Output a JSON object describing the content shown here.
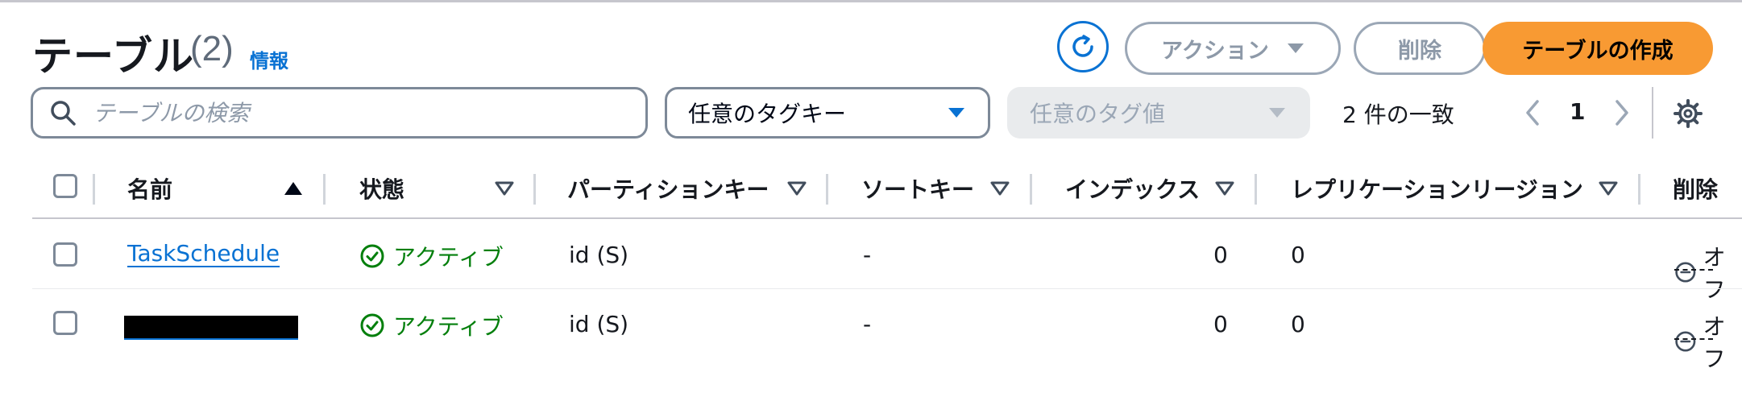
{
  "header": {
    "title": "テーブル",
    "count": "(2)",
    "info_link": "情報",
    "buttons": {
      "actions": "アクション",
      "delete": "削除",
      "create": "テーブルの作成"
    }
  },
  "filters": {
    "search_placeholder": "テーブルの検索",
    "tag_key_select": "任意のタグキー",
    "tag_value_select": "任意のタグ値",
    "match_count": "2 件の一致"
  },
  "pagination": {
    "current_page": "1"
  },
  "table": {
    "columns": {
      "name": "名前",
      "status": "状態",
      "partition_key": "パーティションキー",
      "sort_key": "ソートキー",
      "indexes": "インデックス",
      "replication_regions": "レプリケーションリージョン",
      "deletion_protection": "削除"
    },
    "rows": [
      {
        "name": "TaskSchedule",
        "status": "アクティブ",
        "partition_key": "id (S)",
        "sort_key": "-",
        "indexes": "0",
        "replication_regions": "0",
        "deletion_protection": "オフ"
      },
      {
        "name": "",
        "status": "アクティブ",
        "partition_key": "id (S)",
        "sort_key": "-",
        "indexes": "0",
        "replication_regions": "0",
        "deletion_protection": "オフ"
      }
    ]
  },
  "colors": {
    "link": "#0972d3",
    "primary_button": "#f89a33",
    "status_active": "#037f0c",
    "disabled_text": "#8d99a8"
  },
  "icons": [
    "refresh-icon",
    "caret-down-icon",
    "search-icon",
    "chevron-left-icon",
    "chevron-right-icon",
    "settings-gear-icon",
    "sort-ascending-icon",
    "sort-icon",
    "status-success-icon",
    "status-stopped-icon"
  ]
}
